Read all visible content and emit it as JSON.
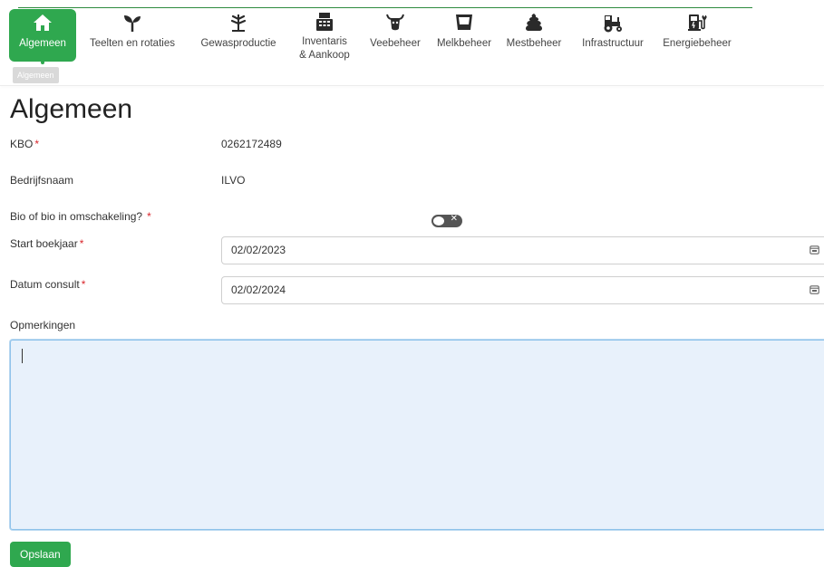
{
  "nav": {
    "items": [
      {
        "label": "Algemeen",
        "icon": "home-icon"
      },
      {
        "label": "Teelten en rotaties",
        "icon": "sprout-icon"
      },
      {
        "label": "Gewasproductie",
        "icon": "plant-icon"
      },
      {
        "label": "Inventaris",
        "label2": "& Aankoop",
        "icon": "cash-register-icon"
      },
      {
        "label": "Veebeheer",
        "icon": "cow-icon"
      },
      {
        "label": "Melkbeheer",
        "icon": "milk-container-icon"
      },
      {
        "label": "Mestbeheer",
        "icon": "manure-icon"
      },
      {
        "label": "Infrastructuur",
        "icon": "tractor-icon"
      },
      {
        "label": "Energiebeheer",
        "icon": "ev-charger-icon"
      }
    ],
    "tooltip": "Algemeen",
    "active_color": "#2fa84f"
  },
  "page_title": "Algemeen",
  "form": {
    "kbo_label": "KBO",
    "kbo_value": "0262172489",
    "bedrijfsnaam_label": "Bedrijfsnaam",
    "bedrijfsnaam_value": "ILVO",
    "bio_label": "Bio of bio in omschakeling?",
    "bio_value": false,
    "start_label": "Start boekjaar",
    "start_value": "02/02/2023",
    "consult_label": "Datum consult",
    "consult_value": "02/02/2024",
    "opmerkingen_label": "Opmerkingen",
    "opmerkingen_value": "",
    "required_marker": "*"
  },
  "save_label": "Opslaan"
}
